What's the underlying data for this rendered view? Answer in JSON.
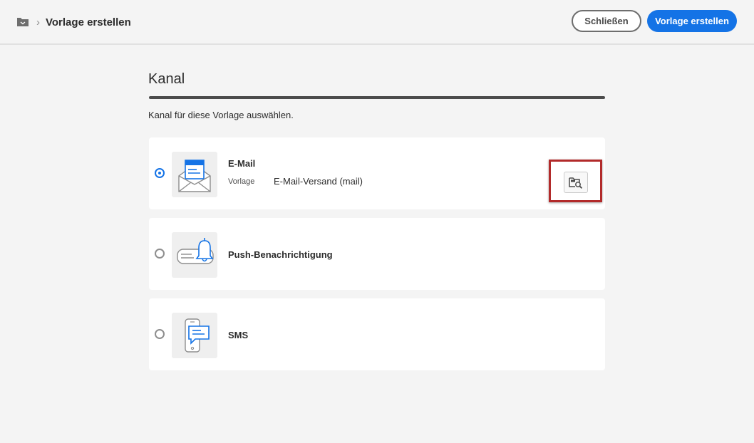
{
  "header": {
    "breadcrumb_icon": "folder-icon",
    "breadcrumb_separator": "›",
    "title": "Vorlage erstellen",
    "close_label": "Schließen",
    "create_label": "Vorlage erstellen"
  },
  "section": {
    "title": "Kanal",
    "subtitle": "Kanal für diese Vorlage auswählen."
  },
  "channels": [
    {
      "name": "E-Mail",
      "icon": "email-envelope-icon",
      "selected": true,
      "template_label": "Vorlage",
      "template_value": "E-Mail-Versand (mail)",
      "browse_icon": "folder-search-icon"
    },
    {
      "name": "Push-Benachrichtigung",
      "icon": "push-bell-icon",
      "selected": false
    },
    {
      "name": "SMS",
      "icon": "sms-phone-icon",
      "selected": false
    }
  ],
  "colors": {
    "accent": "#1473e6",
    "highlight": "#b22a2a",
    "background": "#f4f4f4"
  }
}
